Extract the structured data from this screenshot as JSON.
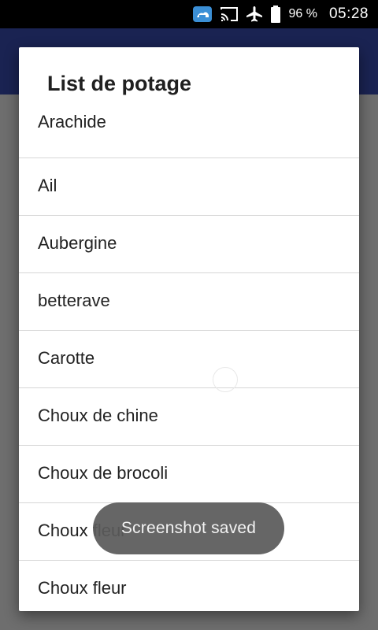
{
  "status_bar": {
    "icons": [
      "app-notification-icon",
      "cast-icon",
      "airplane-mode-icon",
      "battery-icon"
    ],
    "battery_percent": "96 %",
    "time": "05:28"
  },
  "dialog": {
    "title": "List de potage",
    "items": [
      {
        "label": "Arachide"
      },
      {
        "label": "Ail"
      },
      {
        "label": "Aubergine"
      },
      {
        "label": "betterave"
      },
      {
        "label": "Carotte"
      },
      {
        "label": "Choux de chine"
      },
      {
        "label": "Choux de brocoli"
      },
      {
        "label": "Choux fleur"
      },
      {
        "label": "Choux fleur"
      }
    ]
  },
  "toast": {
    "text": "Screenshot saved"
  },
  "colors": {
    "status_bar": "#000000",
    "app_bar": "#1a2352",
    "scrim": "#6e6e6e",
    "dialog_bg": "#ffffff",
    "divider": "#d6d6d6",
    "toast_bg": "#5a5a5a"
  }
}
